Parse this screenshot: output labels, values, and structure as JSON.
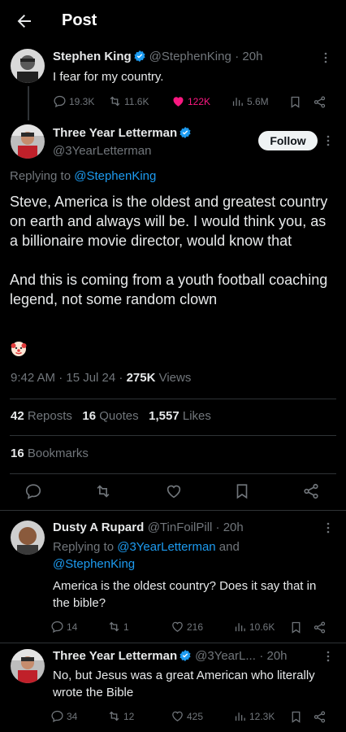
{
  "header": {
    "title": "Post"
  },
  "parent_tweet": {
    "name": "Stephen King",
    "handle": "@StephenKing",
    "time": "· 20h",
    "text": "I fear for my country.",
    "replies": "19.3K",
    "reposts": "11.6K",
    "likes": "122K",
    "views": "5.6M"
  },
  "main_tweet": {
    "name": "Three Year Letterman",
    "handle": "@3YearLetterman",
    "follow_label": "Follow",
    "replying_prefix": "Replying to ",
    "replying_to": "@StephenKing",
    "paragraph1": "Steve, America is the oldest and greatest country on earth and always will be. I would think you, as a billionaire movie director, would know that",
    "paragraph2": "And this is coming from a youth football coaching legend, not some random clown",
    "timestamp": "9:42 AM · 15 Jul 24 · ",
    "views_count": "275K",
    "views_label": " Views",
    "reposts_count": "42",
    "reposts_label": " Reposts",
    "quotes_count": "16",
    "quotes_label": " Quotes",
    "likes_count": "1,557",
    "likes_label": " Likes",
    "bookmarks_count": "16",
    "bookmarks_label": " Bookmarks"
  },
  "replies": [
    {
      "name": "Dusty A Rupard",
      "handle": "@TinFoilPill · 20h",
      "replying_prefix": "Replying to ",
      "replying_to_1": "@3YearLetterman",
      "replying_and": " and",
      "replying_to_2": "@StephenKing",
      "text": "America is the oldest country? Does it say that in the bible?",
      "replies": "14",
      "reposts": "1",
      "likes": "216",
      "views": "10.6K"
    },
    {
      "name": "Three Year Letterman",
      "handle": "@3YearL...",
      "time": "· 20h",
      "text": "No, but Jesus was a great American who literally wrote the Bible",
      "replies": "34",
      "reposts": "12",
      "likes": "425",
      "views": "12.3K"
    }
  ],
  "colors": {
    "background": "#000000",
    "accent": "#1d9bf0",
    "like": "#f91880",
    "muted": "#71767b"
  }
}
